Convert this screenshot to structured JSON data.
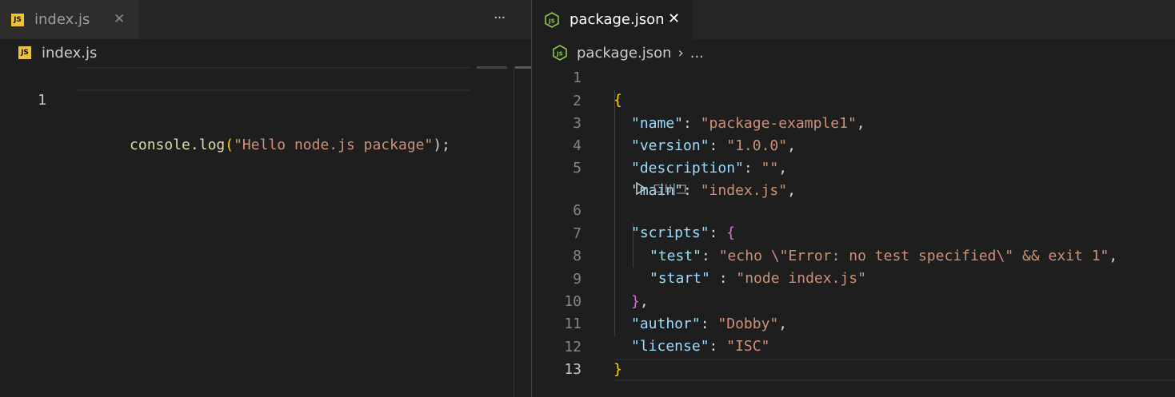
{
  "left": {
    "tab": {
      "label": "index.js",
      "badge": "JS",
      "close": "✕",
      "more": "···"
    },
    "breadcrumb": {
      "badge": "JS",
      "file": "index.js"
    },
    "lines": [
      {
        "num": "1",
        "fn": "console.log",
        "open": "(",
        "str": "\"Hello node.js package\"",
        "close": ");"
      }
    ]
  },
  "right": {
    "tab": {
      "label": "package.json",
      "badge": "JS",
      "close": "✕"
    },
    "breadcrumb": {
      "badge": "JS",
      "file": "package.json",
      "sep": "›",
      "more": "..."
    },
    "codelens": "디버그",
    "line_numbers": [
      "1",
      "2",
      "3",
      "4",
      "5",
      "6",
      "7",
      "8",
      "9",
      "10",
      "11",
      "12",
      "13"
    ],
    "code": {
      "open_brace": "{",
      "name_key": "\"name\"",
      "name_val": "\"package-example1\"",
      "version_key": "\"version\"",
      "version_val": "\"1.0.0\"",
      "description_key": "\"description\"",
      "description_val": "\"\"",
      "main_key": "\"main\"",
      "main_val": "\"index.js\"",
      "scripts_key": "\"scripts\"",
      "scripts_open": "{",
      "test_key": "\"test\"",
      "test_val": "\"echo \\\"Error: no test specified\\\" && exit 1\"",
      "start_key": "\"start\"",
      "start_val": "\"node index.js\"",
      "scripts_close": "}",
      "author_key": "\"author\"",
      "author_val": "\"Dobby\"",
      "license_key": "\"license\"",
      "license_val": "\"ISC\"",
      "close_brace": "}"
    }
  },
  "colors": {
    "editor_bg": "#1e1e1e",
    "tabbar_bg": "#252526",
    "key": "#9cdcfe",
    "string": "#ce9178",
    "function": "#dcdcaa",
    "bracket_gold": "#ffd700",
    "bracket_purple": "#da70d6",
    "node_green": "#8cc84b"
  },
  "icons": {
    "js_file": "js-file-icon",
    "node_file": "nodejs-icon",
    "close": "close-icon",
    "more": "more-actions-icon",
    "codelens": "play-icon"
  }
}
